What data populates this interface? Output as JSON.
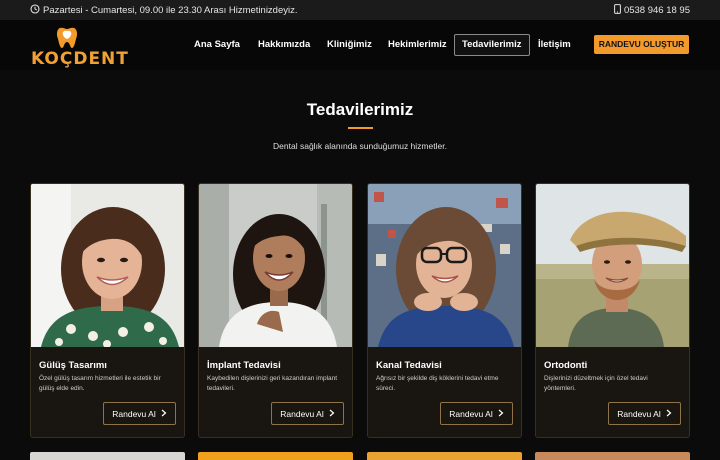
{
  "topbar": {
    "hours": "Pazartesi - Cumartesi, 09.00 ile 23.30 Arası Hizmetinizdeyiz.",
    "phone": "0538 946 18 95"
  },
  "brand": {
    "logo_text": "KOÇDENT"
  },
  "nav": {
    "items": [
      "Ana Sayfa",
      "Hakkımızda",
      "Kliniğimiz",
      "Hekimlerimiz",
      "Tedavilerimiz",
      "İletişim"
    ],
    "active": "Tedavilerimiz",
    "cta": "RANDEVU OLUŞTUR"
  },
  "section": {
    "title": "Tedavilerimiz",
    "subtitle": "Dental sağlık alanında sunduğumuz hizmetler."
  },
  "cards": [
    {
      "title": "Gülüş Tasarımı",
      "desc": "Özel gülüş tasarım hizmetleri ile estetik bir gülüş elde edin.",
      "button": "Randevu Al"
    },
    {
      "title": "İmplant Tedavisi",
      "desc": "Kaybedilen dişlerinizi geri kazandıran implant tedavileri.",
      "button": "Randevu Al"
    },
    {
      "title": "Kanal Tedavisi",
      "desc": "Ağrısız bir şekilde diş köklerini tedavi etme süreci.",
      "button": "Randevu Al"
    },
    {
      "title": "Ortodonti",
      "desc": "Dişlerinizi düzeltmek için özel tedavi yöntemleri.",
      "button": "Randevu Al"
    }
  ],
  "colors": {
    "accent": "#f39a2c",
    "background": "#0b0b0b",
    "card": "#191511"
  },
  "icons": {
    "hours": "clock-icon",
    "phone": "phone-icon",
    "button": "chevron-right-icon",
    "logo": "tooth-icon"
  }
}
